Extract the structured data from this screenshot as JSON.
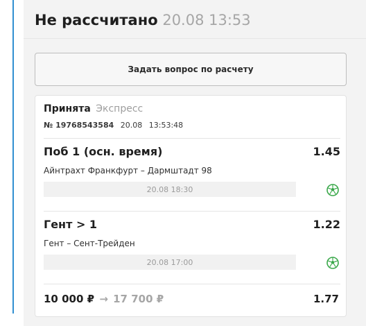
{
  "header": {
    "status": "Не рассчитано",
    "time": "20.08 13:53"
  },
  "ask_button": {
    "label": "Задать вопрос по расчету"
  },
  "bet": {
    "status": "Принята",
    "type": "Экспресс",
    "number": "№ 19768543584",
    "date": "20.08",
    "time": "13:53:48",
    "selections": [
      {
        "name": "Поб 1 (осн. время)",
        "odds": "1.45",
        "event": "Айнтрахт Франкфурт – Дармштадт 98",
        "start": "20.08 18:30",
        "sport_icon": "football-icon"
      },
      {
        "name": "Гент > 1",
        "odds": "1.22",
        "event": "Гент – Сент-Трейден",
        "start": "20.08 17:00",
        "sport_icon": "football-icon"
      }
    ],
    "stake": "10 000 ₽",
    "arrow": "→",
    "payout": "17 700 ₽",
    "total_odds": "1.77"
  },
  "colors": {
    "accent_bar": "#2f8fd1",
    "sport_icon": "#3aa84a",
    "muted_text": "#a6a6a6"
  }
}
